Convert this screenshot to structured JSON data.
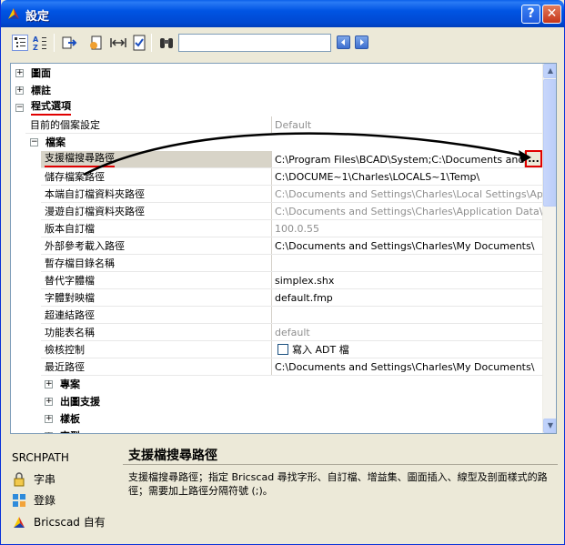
{
  "window": {
    "title": "設定",
    "help_label": "?",
    "close_label": "✕"
  },
  "toolbar": {
    "search_value": "",
    "icons": [
      "categorized-icon",
      "alphabetical-icon",
      "export-icon",
      "import-icon",
      "width-icon",
      "checklist-icon",
      "binoculars-icon",
      "prev-icon",
      "next-icon"
    ]
  },
  "tree": {
    "groups_top": [
      {
        "label": "圖面",
        "expander": "+"
      },
      {
        "label": "標註",
        "expander": "+"
      },
      {
        "label": "程式選項",
        "expander": "−"
      }
    ],
    "current_profile": {
      "name": "目前的個案設定",
      "value": "Default"
    },
    "files_group": {
      "label": "檔案",
      "expander": "−"
    },
    "properties": [
      {
        "name": "支援檔搜尋路徑",
        "value": "C:\\Program Files\\BCAD\\System;C:\\Documents and S",
        "gray": false
      },
      {
        "name": "儲存檔案路徑",
        "value": "C:\\DOCUME~1\\Charles\\LOCALS~1\\Temp\\",
        "gray": false
      },
      {
        "name": "本端自訂檔資料夾路徑",
        "value": "C:\\Documents and Settings\\Charles\\Local Settings\\App",
        "gray": true
      },
      {
        "name": "漫遊自訂檔資料夾路徑",
        "value": "C:\\Documents and Settings\\Charles\\Application Data\\Br",
        "gray": true
      },
      {
        "name": "版本自訂檔",
        "value": "100.0.55",
        "gray": true
      },
      {
        "name": "外部參考載入路徑",
        "value": "C:\\Documents and Settings\\Charles\\My Documents\\",
        "gray": false
      },
      {
        "name": "暫存檔目錄名稱",
        "value": "",
        "gray": false
      },
      {
        "name": "替代字體檔",
        "value": "simplex.shx",
        "gray": false
      },
      {
        "name": "字體對映檔",
        "value": "default.fmp",
        "gray": false
      },
      {
        "name": "超連結路徑",
        "value": "",
        "gray": false
      },
      {
        "name": "功能表名稱",
        "value": "default",
        "gray": true
      },
      {
        "name": "檢核控制",
        "value": "寫入 ADT 檔",
        "gray": false
      },
      {
        "name": "最近路徑",
        "value": "C:\\Documents and Settings\\Charles\\My Documents\\",
        "gray": false
      }
    ],
    "ellipsis_label": "...",
    "groups_bottom": [
      {
        "label": "專案",
        "expander": "+"
      },
      {
        "label": "出圖支援",
        "expander": "+"
      },
      {
        "label": "樣板",
        "expander": "+"
      },
      {
        "label": "字型",
        "expander": "+"
      }
    ]
  },
  "info": {
    "variable": "SRCHPATH",
    "type": "字串",
    "storage": "登錄",
    "owner": "Bricscad 自有"
  },
  "description": {
    "title": "支援檔搜尋路徑",
    "body": "支援檔搜尋路徑；指定 Bricscad 尋找字形、自訂檔、增益集、圖面插入、線型及剖面樣式的路徑；需要加上路徑分隔符號 (;)。"
  },
  "colors": {
    "accent": "#0054E3",
    "annotation_red": "#E00000",
    "selected_row": "#C8C4B8"
  }
}
